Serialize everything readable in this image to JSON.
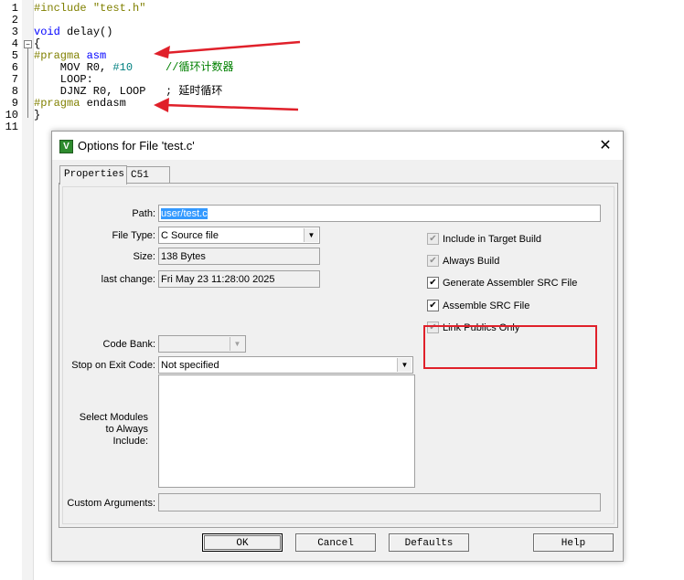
{
  "editor": {
    "lines": [
      {
        "n": "1",
        "parts": [
          {
            "t": "#include ",
            "c": "pp"
          },
          {
            "t": "\"test.h\"",
            "c": "pp"
          }
        ]
      },
      {
        "n": "2",
        "parts": []
      },
      {
        "n": "3",
        "parts": [
          {
            "t": "void",
            "c": "kw"
          },
          {
            "t": " delay()",
            "c": "str"
          }
        ]
      },
      {
        "n": "4",
        "parts": [
          {
            "t": "{",
            "c": "str"
          }
        ]
      },
      {
        "n": "5",
        "parts": [
          {
            "t": "#pragma ",
            "c": "pp"
          },
          {
            "t": "asm",
            "c": "kw"
          }
        ]
      },
      {
        "n": "6",
        "parts": [
          {
            "t": "    MOV R0, ",
            "c": "str"
          },
          {
            "t": "#10",
            "c": "num"
          },
          {
            "t": "     //循环计数器",
            "c": "cmt"
          }
        ]
      },
      {
        "n": "7",
        "parts": [
          {
            "t": "    LOOP:",
            "c": "str"
          }
        ]
      },
      {
        "n": "8",
        "parts": [
          {
            "t": "    DJNZ R0, LOOP   ; 延时循环",
            "c": "str"
          }
        ]
      },
      {
        "n": "9",
        "parts": [
          {
            "t": "#pragma ",
            "c": "pp"
          },
          {
            "t": "endasm",
            "c": "str"
          }
        ]
      },
      {
        "n": "10",
        "parts": [
          {
            "t": "}",
            "c": "str"
          }
        ]
      },
      {
        "n": "11",
        "parts": []
      }
    ]
  },
  "dialog": {
    "title": "Options for File 'test.c'",
    "close_glyph": "✕",
    "tabs": [
      "Properties",
      "C51"
    ],
    "path_label": "Path:",
    "path_value": "user/test.c",
    "file_type_label": "File Type:",
    "file_type_value": "C Source file",
    "size_label": "Size:",
    "size_value": "138 Bytes",
    "last_change_label": "last change:",
    "last_change_value": "Fri May 23 11:28:00 2025",
    "code_bank_label": "Code Bank:",
    "code_bank_value": "",
    "stop_exit_label": "Stop on Exit Code:",
    "stop_exit_value": "Not specified",
    "select_modules_label": "Select Modules to Always Include:",
    "custom_args_label": "Custom Arguments:",
    "checkboxes": [
      {
        "label": "Include in Target Build",
        "checked": true,
        "enabled": false
      },
      {
        "label": "Always Build",
        "checked": true,
        "enabled": false
      },
      {
        "label": "Generate Assembler SRC File",
        "checked": true,
        "enabled": true
      },
      {
        "label": "Assemble SRC File",
        "checked": true,
        "enabled": true
      },
      {
        "label": "Link Publics Only",
        "checked": true,
        "enabled": false
      }
    ],
    "check_glyph": "✔",
    "buttons": {
      "ok": "OK",
      "cancel": "Cancel",
      "defaults": "Defaults",
      "help": "Help"
    }
  },
  "colors": {
    "annotation_red": "#e0202a",
    "selection": "#3399ff",
    "keil_green": "#2e8b2e"
  }
}
